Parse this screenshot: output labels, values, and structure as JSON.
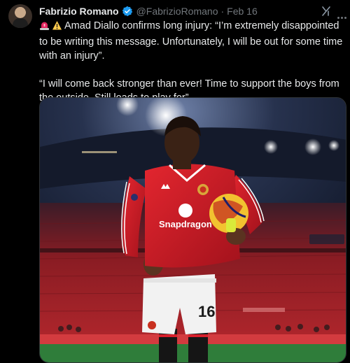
{
  "author": {
    "name": "Fabrizio Romano",
    "handle": "@FabrizioRomano",
    "separator": "·",
    "date": "Feb 16",
    "verified": true
  },
  "icons": {
    "avatar": "profile-photo",
    "verified": "verified-badge-icon",
    "grok": "grok-icon",
    "more": "more-icon",
    "emoji_1": "siren-emoji",
    "emoji_2": "warning-emoji"
  },
  "tweet": {
    "paragraph_1": "Amad Diallo confirms long injury: “I’m extremely disappointed to be writing this message. Unfortunately, I will be out for some time with an injury”.",
    "paragraph_2": "“I will come back stronger than ever! Time to support the boys from the outside. Still loads to play for”."
  },
  "photo": {
    "sponsor": "Snapdragon",
    "shirt_number": "16",
    "description_colors": {
      "shirt": "#d71f2b",
      "shorts": "#f2f2f2",
      "socks": "#151515",
      "stands": "#8f1e22",
      "pitch": "#2f7d3a"
    }
  },
  "colors": {
    "accent": "#1d9bf0",
    "text": "#e7e9ea",
    "muted": "#71767b"
  }
}
